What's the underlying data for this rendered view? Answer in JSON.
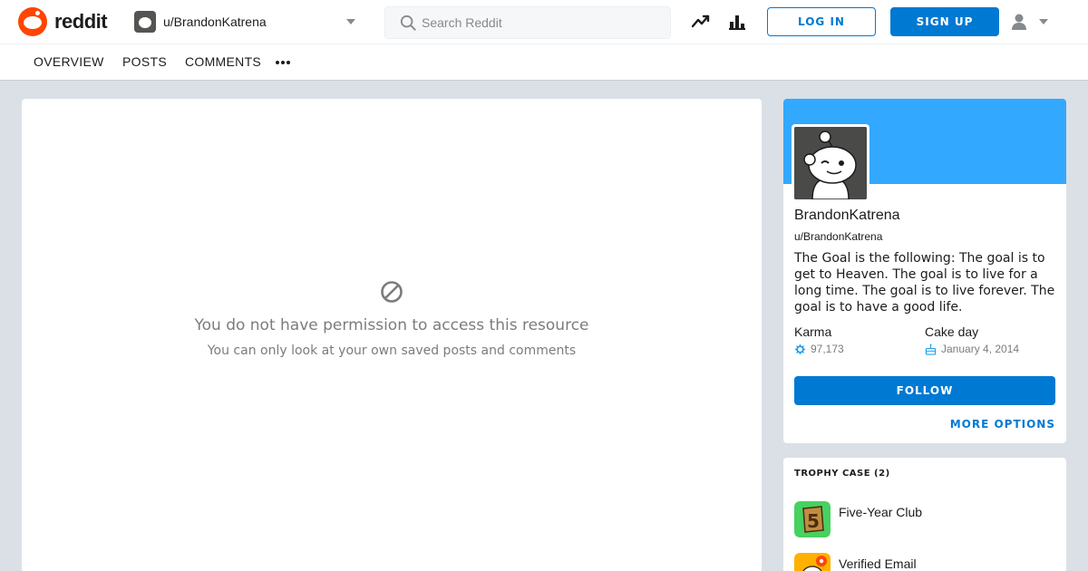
{
  "header": {
    "logo_text": "reddit",
    "user_dropdown_label": "u/BrandonKatrena",
    "search_placeholder": "Search Reddit",
    "login_label": "LOG IN",
    "signup_label": "SIGN UP",
    "icons": [
      "trending-icon",
      "stats-icon",
      "user-icon",
      "chevron-down-icon"
    ]
  },
  "tabs": {
    "items": [
      {
        "label": "OVERVIEW"
      },
      {
        "label": "POSTS"
      },
      {
        "label": "COMMENTS"
      }
    ]
  },
  "main": {
    "error_title": "You do not have permission to access this resource",
    "error_subtitle": "You can only look at your own saved posts and comments"
  },
  "profile": {
    "display_name": "BrandonKatrena",
    "handle": "u/BrandonKatrena",
    "bio": "The Goal is the following: The goal is to get to Heaven. The goal is to live for a long time. The goal is to live forever. The goal is to have a good life.",
    "karma_label": "Karma",
    "karma_value": "97,173",
    "cakeday_label": "Cake day",
    "cakeday_value": "January 4, 2014",
    "follow_label": "FOLLOW",
    "more_options_label": "MORE OPTIONS"
  },
  "trophies": {
    "title": "TROPHY CASE (2)",
    "items": [
      {
        "name": "Five-Year Club"
      },
      {
        "name": "Verified Email"
      }
    ]
  },
  "colors": {
    "brand": "#ff4500",
    "accent": "#0079d3",
    "banner": "#33a8ff",
    "background": "#dae0e6"
  }
}
